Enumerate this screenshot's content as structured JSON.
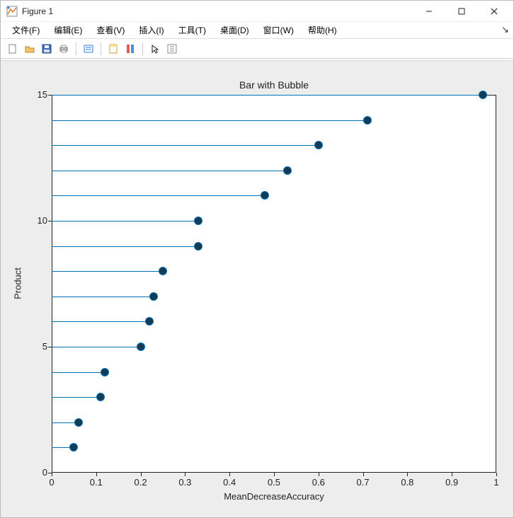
{
  "window": {
    "title": "Figure 1"
  },
  "menu": {
    "items": [
      "文件(F)",
      "编辑(E)",
      "查看(V)",
      "插入(I)",
      "工具(T)",
      "桌面(D)",
      "窗口(W)",
      "帮助(H)"
    ]
  },
  "toolbar": {
    "icons": [
      "new-figure-icon",
      "open-icon",
      "save-icon",
      "print-icon",
      "sep",
      "link-icon",
      "sep",
      "datatip-icon",
      "colorbar-icon",
      "sep",
      "pointer-icon",
      "inspect-icon"
    ]
  },
  "chart_data": {
    "type": "bar",
    "orientation": "horizontal",
    "title": "Bar with Bubble",
    "xlabel": "MeanDecreaseAccuracy",
    "ylabel": "Product",
    "xlim": [
      0,
      1
    ],
    "ylim": [
      0,
      15
    ],
    "xticks": [
      0,
      0.1,
      0.2,
      0.3,
      0.4,
      0.5,
      0.6,
      0.7,
      0.8,
      0.9,
      1
    ],
    "yticks": [
      0,
      5,
      10,
      15
    ],
    "categories": [
      1,
      2,
      3,
      4,
      5,
      6,
      7,
      8,
      9,
      10,
      11,
      12,
      13,
      14,
      15
    ],
    "values": [
      0.05,
      0.06,
      0.11,
      0.12,
      0.2,
      0.22,
      0.23,
      0.25,
      0.33,
      0.33,
      0.48,
      0.53,
      0.6,
      0.71,
      0.97
    ],
    "bar_color": "#0072bd",
    "bubble_color": "#133b53"
  }
}
